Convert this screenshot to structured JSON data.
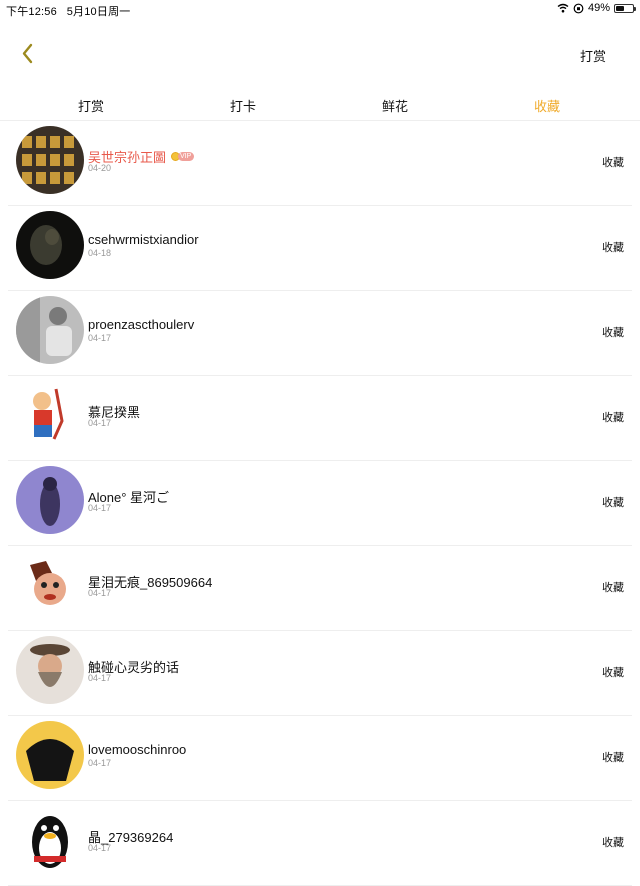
{
  "status_bar": {
    "time": "下午12:56",
    "date": "5月10日周一",
    "battery": "49%",
    "battery_level": 0.49
  },
  "nav": {
    "back_icon": "chevron-left-icon",
    "action_label": "打赏"
  },
  "tabs": [
    {
      "label": "打赏",
      "active": false
    },
    {
      "label": "打卡",
      "active": false
    },
    {
      "label": "鲜花",
      "active": false
    },
    {
      "label": "收藏",
      "active": true
    }
  ],
  "colors": {
    "accent": "#f0ab2c",
    "vip_name": "#e8594b"
  },
  "list": {
    "items": [
      {
        "name": "吴世宗孙正圖",
        "date": "04-20",
        "action": "收藏",
        "vip": true,
        "vip_label": "VIP"
      },
      {
        "name": "csehwrmistxiandior",
        "date": "04-18",
        "action": "收藏"
      },
      {
        "name": "proenzascthoulerv",
        "date": "04-17",
        "action": "收藏"
      },
      {
        "name": "慕尼揆黑",
        "date": "04-17",
        "action": "收藏"
      },
      {
        "name": "Alone° 星河ご",
        "date": "04-17",
        "action": "收藏"
      },
      {
        "name": "星泪无痕_869509664",
        "date": "04-17",
        "action": "收藏"
      },
      {
        "name": "触碰心灵劣的话",
        "date": "04-17",
        "action": "收藏"
      },
      {
        "name": "lovemooschinroo",
        "date": "04-17",
        "action": "收藏"
      },
      {
        "name": "晶_279369264",
        "date": "04-17",
        "action": "收藏"
      }
    ]
  }
}
